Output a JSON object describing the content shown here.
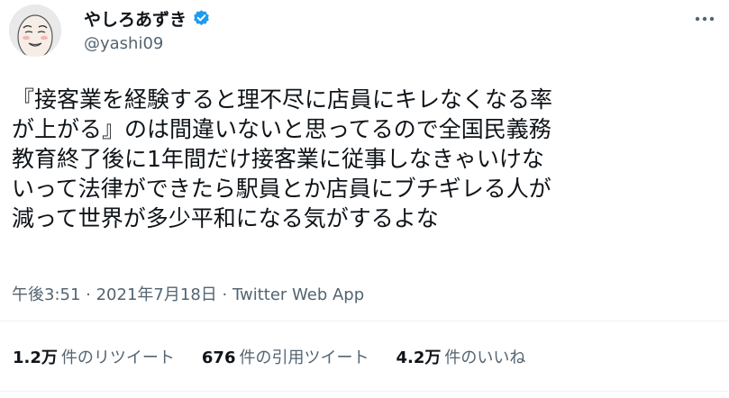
{
  "author": {
    "display_name": "やしろあずき",
    "handle": "@yashi09",
    "verified": true,
    "verified_color": "#1d9bf0"
  },
  "more_icon": "more-horizontal-icon",
  "tweet": {
    "lines": [
      "『接客業を経験すると理不尽に店員にキレなくなる率",
      "が上がる』のは間違いないと思ってるので全国民義務",
      "教育終了後に1年間だけ接客業に従事しなきゃいけな",
      "いって法律ができたら駅員とか店員にブチギレる人が",
      "減って世界が多少平和になる気がするよな"
    ]
  },
  "meta": {
    "time": "午後3:51",
    "separator": "·",
    "date": "2021年7月18日",
    "source": "Twitter Web App"
  },
  "stats": [
    {
      "count": "1.2万",
      "label": "件のリツイート"
    },
    {
      "count": "676",
      "label": "件の引用ツイート"
    },
    {
      "count": "4.2万",
      "label": "件のいいね"
    }
  ]
}
